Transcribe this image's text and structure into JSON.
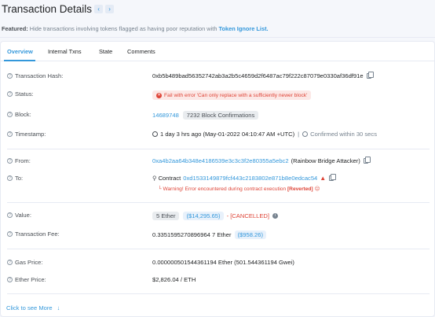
{
  "header": {
    "title": "Transaction Details",
    "prev_icon": "‹",
    "next_icon": "›"
  },
  "featured": {
    "prefix": "Featured:",
    "text": " Hide transactions involving tokens flagged as having poor reputation with ",
    "link": "Token Ignore List."
  },
  "tabs": [
    {
      "label": "Overview",
      "active": true
    },
    {
      "label": "Internal Txns",
      "active": false
    },
    {
      "label": "State",
      "active": false
    },
    {
      "label": "Comments",
      "active": false
    }
  ],
  "rows": {
    "hash": {
      "label": "Transaction Hash:",
      "value": "0xb5b489bad56352742ab3a2b5c4659d2f6487ac79f222c87079e0330af36df91e"
    },
    "status": {
      "label": "Status:",
      "value": "Fail with error 'Can only replace with a sufficiently newer block'"
    },
    "block": {
      "label": "Block:",
      "value": "14689748",
      "confirmations": "7232 Block Confirmations"
    },
    "timestamp": {
      "label": "Timestamp:",
      "value": "1 day 3 hrs ago (May-01-2022 04:10:47 AM +UTC)",
      "confirmed": "Confirmed within 30 secs"
    },
    "from": {
      "label": "From:",
      "address": "0xa4b2aa64b348e4186539e3c3c3f2e80355a5ebc2",
      "tag": "(Rainbow Bridge Attacker)"
    },
    "to": {
      "label": "To:",
      "prefix": "Contract",
      "address": "0xd1533149879fcf443c2183802e871b8e0edcac54",
      "warning": "Warning! Error encountered during contract execution ",
      "warning_tag": "[Reverted]"
    },
    "value": {
      "label": "Value:",
      "amount": "5 Ether",
      "usd": "($14,295.65)",
      "cancelled": "- [CANCELLED]"
    },
    "fee": {
      "label": "Transaction Fee:",
      "amount": "0.3351595270896964 7 Ether",
      "usd": "($958.26)"
    },
    "gas": {
      "label": "Gas Price:",
      "value": "0.000000501544361194 Ether (501.544361194 Gwei)"
    },
    "ether_price": {
      "label": "Ether Price:",
      "value": "$2,826.04 / ETH"
    }
  },
  "more": {
    "label": "Click to see More",
    "icon": "↓"
  },
  "colors": {
    "accent": "#3498db",
    "danger": "#de4437",
    "muted": "#77838f"
  },
  "icons": {
    "help": "question-circle-icon",
    "copy": "copy-icon",
    "clock": "clock-icon",
    "warning": "warning-triangle-icon",
    "contract": "search-contract-icon",
    "info": "info-icon"
  }
}
